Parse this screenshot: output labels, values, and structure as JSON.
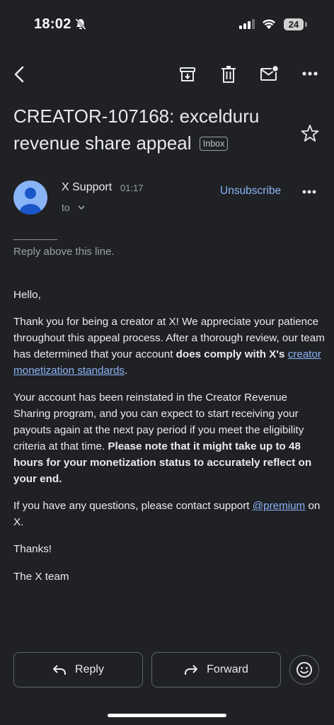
{
  "status_bar": {
    "time": "18:02",
    "battery": "24"
  },
  "toolbar": {
    "icons": [
      "back-arrow-icon",
      "archive-icon",
      "delete-icon",
      "mark-unread-icon",
      "more-icon"
    ]
  },
  "email": {
    "subject": "CREATOR-107168: excelduru revenue share appeal",
    "label": "Inbox",
    "sender": "X Support",
    "time": "01:17",
    "to": "to",
    "unsubscribe": "Unsubscribe",
    "separator": "________",
    "reply_above": "Reply above this line.",
    "greeting": "Hello,",
    "p1_a": "Thank you for being a creator at X! We appreciate your patience throughout this appeal process. After a thorough review, our team has determined that your account ",
    "p1_bold": "does comply with X's",
    "p1_space": " ",
    "p1_link": "creator monetization standards",
    "p1_end": ".",
    "p2_a": "Your account has been reinstated in the Creator Revenue Sharing program, and you can expect to start receiving your payouts again at the next pay period if you meet the eligibility criteria at that time. ",
    "p2_bold": "Please note that it might take up to 48 hours for your monetization status to accurately reflect on your end.",
    "p3_a": "If you have any questions, please contact support ",
    "p3_link": "@premium",
    "p3_end": " on X.",
    "thanks": "Thanks!",
    "signoff": "The X team"
  },
  "actions": {
    "reply": "Reply",
    "forward": "Forward"
  },
  "colors": {
    "background": "#202124",
    "link": "#8ab4f8",
    "muted": "#9aa0a6",
    "avatar": "#8ab4f8"
  }
}
